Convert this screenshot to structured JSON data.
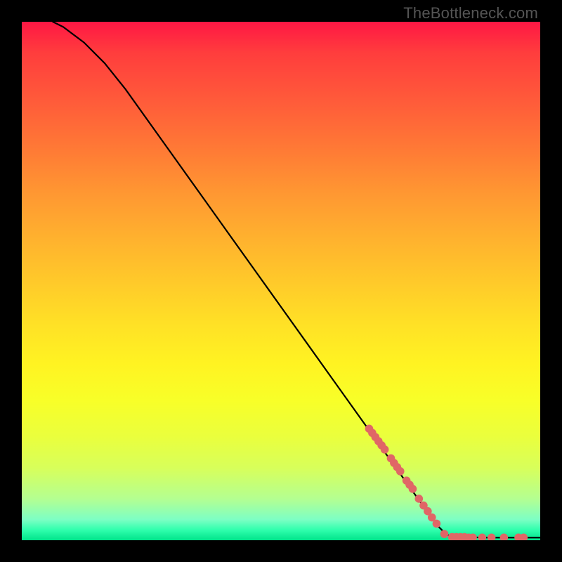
{
  "watermark": "TheBottleneck.com",
  "colors": {
    "background": "#000000",
    "watermark_text": "#555555",
    "curve_stroke": "#000000",
    "dot_fill": "#e06666"
  },
  "chart_data": {
    "type": "line",
    "title": "",
    "xlabel": "",
    "ylabel": "",
    "xlim": [
      0,
      100
    ],
    "ylim": [
      0,
      100
    ],
    "series": [
      {
        "name": "curve",
        "points": [
          {
            "x": 6,
            "y": 100
          },
          {
            "x": 8,
            "y": 99
          },
          {
            "x": 12,
            "y": 96
          },
          {
            "x": 16,
            "y": 92
          },
          {
            "x": 20,
            "y": 87
          },
          {
            "x": 25,
            "y": 80
          },
          {
            "x": 30,
            "y": 73
          },
          {
            "x": 35,
            "y": 66
          },
          {
            "x": 40,
            "y": 59
          },
          {
            "x": 45,
            "y": 52
          },
          {
            "x": 50,
            "y": 45
          },
          {
            "x": 55,
            "y": 38
          },
          {
            "x": 60,
            "y": 31
          },
          {
            "x": 65,
            "y": 24
          },
          {
            "x": 70,
            "y": 17
          },
          {
            "x": 75,
            "y": 10
          },
          {
            "x": 80,
            "y": 3
          },
          {
            "x": 82,
            "y": 1
          },
          {
            "x": 85,
            "y": 0.6
          },
          {
            "x": 90,
            "y": 0.5
          },
          {
            "x": 95,
            "y": 0.5
          },
          {
            "x": 100,
            "y": 0.5
          }
        ]
      },
      {
        "name": "dots",
        "points": [
          {
            "x": 67.0,
            "y": 21.5
          },
          {
            "x": 67.6,
            "y": 20.7
          },
          {
            "x": 68.2,
            "y": 19.9
          },
          {
            "x": 68.8,
            "y": 19.1
          },
          {
            "x": 69.4,
            "y": 18.3
          },
          {
            "x": 70.0,
            "y": 17.5
          },
          {
            "x": 71.2,
            "y": 15.8
          },
          {
            "x": 71.8,
            "y": 14.9
          },
          {
            "x": 72.4,
            "y": 14.1
          },
          {
            "x": 73.0,
            "y": 13.3
          },
          {
            "x": 74.2,
            "y": 11.5
          },
          {
            "x": 74.8,
            "y": 10.7
          },
          {
            "x": 75.4,
            "y": 9.9
          },
          {
            "x": 76.6,
            "y": 8.0
          },
          {
            "x": 77.5,
            "y": 6.7
          },
          {
            "x": 78.3,
            "y": 5.6
          },
          {
            "x": 79.1,
            "y": 4.4
          },
          {
            "x": 80.0,
            "y": 3.2
          },
          {
            "x": 81.5,
            "y": 1.2
          },
          {
            "x": 83.0,
            "y": 0.6
          },
          {
            "x": 83.8,
            "y": 0.6
          },
          {
            "x": 84.6,
            "y": 0.6
          },
          {
            "x": 85.4,
            "y": 0.6
          },
          {
            "x": 86.2,
            "y": 0.5
          },
          {
            "x": 87.0,
            "y": 0.5
          },
          {
            "x": 88.8,
            "y": 0.5
          },
          {
            "x": 90.6,
            "y": 0.5
          },
          {
            "x": 93.0,
            "y": 0.5
          },
          {
            "x": 95.8,
            "y": 0.5
          },
          {
            "x": 96.8,
            "y": 0.5
          }
        ]
      }
    ]
  }
}
